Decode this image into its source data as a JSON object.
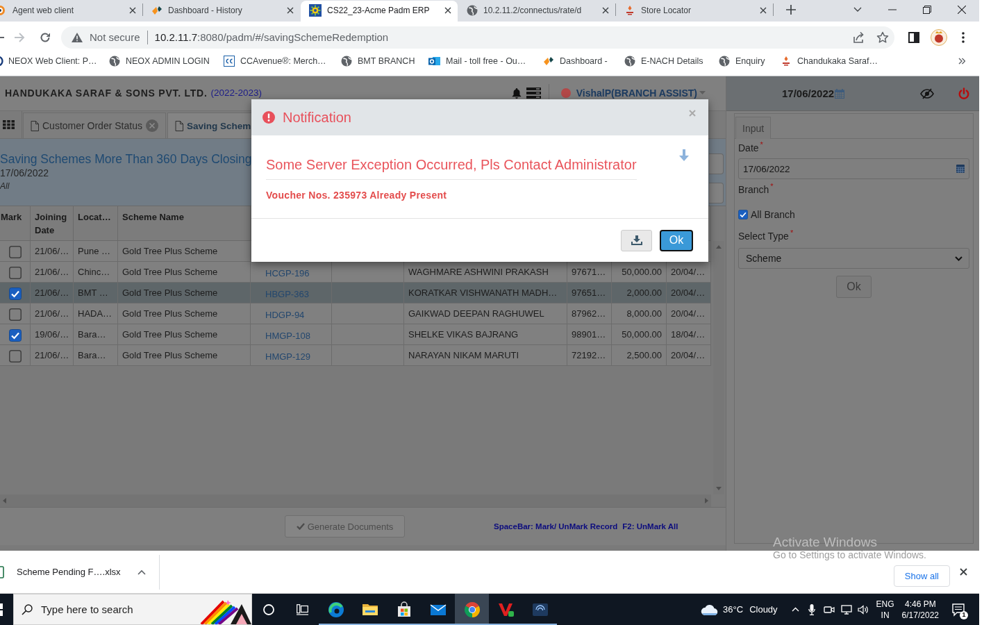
{
  "browser": {
    "tabs": [
      {
        "title": "Agent web client",
        "selected": false
      },
      {
        "title": "Dashboard - History",
        "selected": false
      },
      {
        "title": "CS22_23-Acme Padm ERP",
        "selected": true
      },
      {
        "title": "10.2.11.2/connectus/rate/d",
        "selected": false
      },
      {
        "title": "Store Locator",
        "selected": false
      }
    ],
    "address_bar": {
      "security": "Not secure",
      "host": "10.2.11.7",
      "path": ":8080/padm/#/savingSchemeRedemption"
    },
    "bookmarks": [
      "NEOX Web Client: P…",
      "NEOX ADMIN LOGIN",
      "CCAvenue®: Merch…",
      "BMT BRANCH",
      "Mail - toll free - Ou…",
      "Dashboard -",
      "E-NACH Details",
      "Enquiry",
      "Chandukaka Saraf…"
    ]
  },
  "app": {
    "header": {
      "company": "HANDUKAKA SARAF & SONS PVT. LTD.",
      "year": "(2022-2023)",
      "user": "VishalP(BRANCH ASSIST)",
      "date": "17/06/2022"
    },
    "tabs": [
      {
        "label": "Customer Order Status",
        "selected": false
      },
      {
        "label": "Saving Schem",
        "selected": true
      }
    ],
    "report": {
      "title": "Saving Schemes More Than 360 Days Closing",
      "date": "17/06/2022",
      "filter": "All"
    },
    "table": {
      "columns": [
        "Mark",
        "Joining Date",
        "Locat…",
        "Scheme Name"
      ],
      "rows": [
        {
          "checked": false,
          "selected": false,
          "joining_date": "21/06/…",
          "location": "Pune …",
          "scheme_name": "Gold Tree Plus Scheme"
        },
        {
          "checked": false,
          "selected": false,
          "joining_date": "21/06/…",
          "location": "Chinc…",
          "scheme_name": "Gold Tree Plus Scheme",
          "column_5": "HCGP-196",
          "column_7": "WAGHMARE ASHWINI PRAKASH",
          "column_8": "97671…",
          "column_9": "50,000.00",
          "column_10": "20/04/…"
        },
        {
          "checked": true,
          "selected": true,
          "joining_date": "21/06/…",
          "location": "BMT …",
          "scheme_name": "Gold Tree Plus Scheme",
          "column_5": "HBGP-363",
          "column_7": "KORATKAR VISHWANATH MADH…",
          "column_8": "97651…",
          "column_9": "2,000.00",
          "column_10": "20/04/…"
        },
        {
          "checked": false,
          "selected": false,
          "joining_date": "21/06/…",
          "location": "HADA…",
          "scheme_name": "Gold Tree Plus Scheme",
          "column_5": "HDGP-94",
          "column_7": "GAIKWAD DEEPAN RAGHUWEL",
          "column_8": "87962…",
          "column_9": "8,000.00",
          "column_10": "20/04/…"
        },
        {
          "checked": true,
          "selected": false,
          "joining_date": "19/06/…",
          "location": "Bara…",
          "scheme_name": "Gold Tree Plus Scheme",
          "column_5": "HMGP-108",
          "column_7": "SHELKE VIKAS BAJRANG",
          "column_8": "98901…",
          "column_9": "50,000.00",
          "column_10": "18/04/…"
        },
        {
          "checked": false,
          "selected": false,
          "joining_date": "21/06/…",
          "location": "Bara…",
          "scheme_name": "Gold Tree Plus Scheme",
          "column_5": "HMGP-129",
          "column_7": "NARAYAN NIKAM MARUTI",
          "column_8": "72192…",
          "column_9": "2,500.00",
          "column_10": "20/04/…"
        }
      ]
    },
    "footer": {
      "generate_button": {
        "label": "Generate Documents",
        "disabled": true
      },
      "shortcuts": [
        "SpaceBar: Mark/ UnMark Record",
        "F2: UnMark All"
      ]
    },
    "side_panel": {
      "tab": "Input",
      "date_label": "Date$^{*}$",
      "date_value": "17/06/2022",
      "branch_label": "Branch$^{*}$",
      "all_branch": {
        "label": "All Branch",
        "checked": true
      },
      "type_label": "Select Type$^{*}$",
      "type_value": "Scheme",
      "ok_button": "Ok"
    }
  },
  "modal": {
    "title": "Notification",
    "message": "Some Server Exception Occurred, Pls Contact Administrator",
    "detail": "Voucher Nos. 235973 Already Present",
    "ok_button": "Ok"
  },
  "downloads": {
    "file": "Scheme Pending F….xlsx",
    "show_all": "Show all"
  },
  "taskbar": {
    "search_placeholder": "Type here to search",
    "apps": [
      {
        "selected": false
      },
      {
        "selected": false
      },
      {
        "selected": false
      },
      {
        "selected": false
      },
      {
        "selected": true
      },
      {
        "selected": false
      },
      {
        "selected": false
      }
    ],
    "temperature": "36°C",
    "weather": "Cloudy",
    "language": "ENG",
    "region": "IN",
    "time": "4:46 PM",
    "date": "6/17/2022",
    "notification_count": "1"
  },
  "os_notice": {
    "title": "Activate Windows",
    "text": "Go to Settings to activate Windows."
  }
}
